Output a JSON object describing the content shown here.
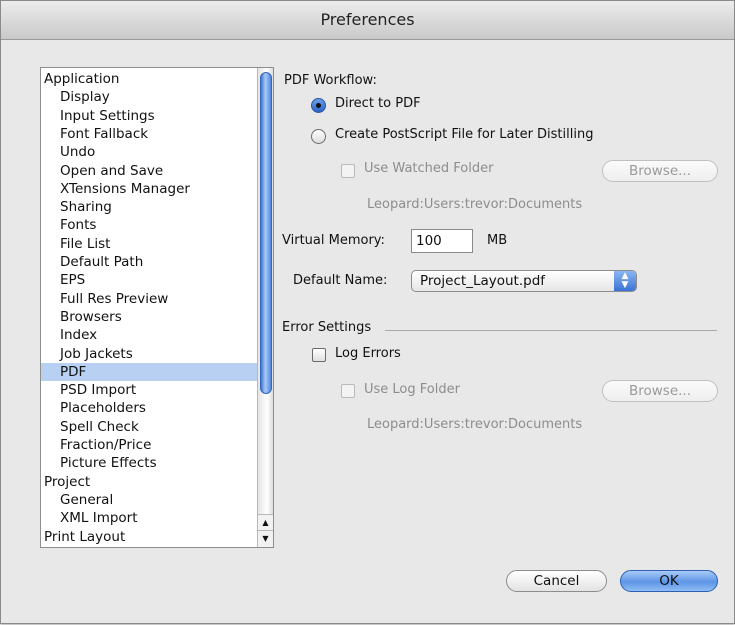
{
  "window": {
    "title": "Preferences"
  },
  "sidebar": {
    "items": [
      {
        "label": "Application",
        "level": "cat",
        "selected": false
      },
      {
        "label": "Display",
        "level": "sub",
        "selected": false
      },
      {
        "label": "Input Settings",
        "level": "sub",
        "selected": false
      },
      {
        "label": "Font Fallback",
        "level": "sub",
        "selected": false
      },
      {
        "label": "Undo",
        "level": "sub",
        "selected": false
      },
      {
        "label": "Open and Save",
        "level": "sub",
        "selected": false
      },
      {
        "label": "XTensions Manager",
        "level": "sub",
        "selected": false
      },
      {
        "label": "Sharing",
        "level": "sub",
        "selected": false
      },
      {
        "label": "Fonts",
        "level": "sub",
        "selected": false
      },
      {
        "label": "File List",
        "level": "sub",
        "selected": false
      },
      {
        "label": "Default Path",
        "level": "sub",
        "selected": false
      },
      {
        "label": "EPS",
        "level": "sub",
        "selected": false
      },
      {
        "label": "Full Res Preview",
        "level": "sub",
        "selected": false
      },
      {
        "label": "Browsers",
        "level": "sub",
        "selected": false
      },
      {
        "label": "Index",
        "level": "sub",
        "selected": false
      },
      {
        "label": "Job Jackets",
        "level": "sub",
        "selected": false
      },
      {
        "label": "PDF",
        "level": "sub",
        "selected": true
      },
      {
        "label": "PSD Import",
        "level": "sub",
        "selected": false
      },
      {
        "label": "Placeholders",
        "level": "sub",
        "selected": false
      },
      {
        "label": "Spell Check",
        "level": "sub",
        "selected": false
      },
      {
        "label": "Fraction/Price",
        "level": "sub",
        "selected": false
      },
      {
        "label": "Picture Effects",
        "level": "sub",
        "selected": false
      },
      {
        "label": "Project",
        "level": "cat",
        "selected": false
      },
      {
        "label": "General",
        "level": "sub",
        "selected": false
      },
      {
        "label": "XML Import",
        "level": "sub",
        "selected": false
      },
      {
        "label": "Print Layout",
        "level": "cat",
        "selected": false
      }
    ],
    "scroll_up_glyph": "▲",
    "scroll_down_glyph": "▼"
  },
  "pdf_workflow": {
    "heading": "PDF Workflow:",
    "direct_label": "Direct to PDF",
    "direct_selected": true,
    "postscript_label": "Create PostScript File for Later Distilling",
    "postscript_selected": false,
    "watched_folder_label": "Use Watched Folder",
    "watched_folder_checked": false,
    "browse_label": "Browse...",
    "path": "Leopard:Users:trevor:Documents"
  },
  "memory": {
    "label": "Virtual Memory:",
    "value": "100",
    "unit": "MB"
  },
  "default_name": {
    "label": "Default Name:",
    "value": "Project_Layout.pdf",
    "arrows": "▲\n▼"
  },
  "error_settings": {
    "heading": "Error Settings",
    "log_errors_label": "Log Errors",
    "log_errors_checked": false,
    "log_folder_label": "Use Log Folder",
    "log_folder_checked": false,
    "browse_label": "Browse...",
    "path": "Leopard:Users:trevor:Documents"
  },
  "buttons": {
    "cancel": "Cancel",
    "ok": "OK"
  },
  "colors": {
    "accent": "#3b73d4",
    "selection": "#b8d1f2",
    "disabled_text": "#8d8d8d"
  }
}
